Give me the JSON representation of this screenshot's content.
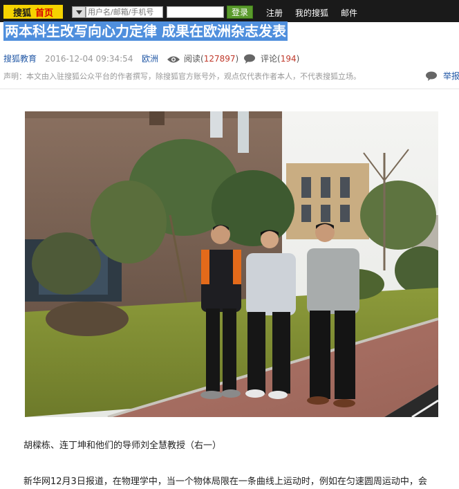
{
  "topbar": {
    "logo_brand": "搜狐",
    "logo_home": "首页",
    "username_placeholder": "用户名/邮箱/手机号",
    "login_button": "登录",
    "register_link": "注册",
    "my_sohu_link": "我的搜狐",
    "mail_link": "邮件",
    "select_icon": "dropdown-arrow-icon"
  },
  "article": {
    "title": "两本科生改写向心力定律 成果在欧洲杂志发表",
    "source": "搜狐教育",
    "date": "2016-12-04 09:34:54",
    "tag": "欧洲",
    "read_label": "阅读",
    "read_count": "127897",
    "comment_label": "评论",
    "comment_count": "194",
    "declaration": "声明：本文由入驻搜狐公众平台的作者撰写，除搜狐官方账号外，观点仅代表作者本人，不代表搜狐立场。",
    "report_label": "举报",
    "caption": "胡樑栋、连丁坤和他们的导师刘全慧教授（右一）",
    "first_paragraph": "新华网12月3日报道，在物理学中，当一个物体局限在一条曲线上运动时，例如在匀速圆周运动中，会"
  },
  "colors": {
    "topbar_bg": "#1a1a1a",
    "logo_bg": "#f5d300",
    "title_highlight": "#4f8fdd",
    "link_blue": "#2258a6",
    "count_red": "#c0392b",
    "login_green": "#5a9b2c"
  }
}
